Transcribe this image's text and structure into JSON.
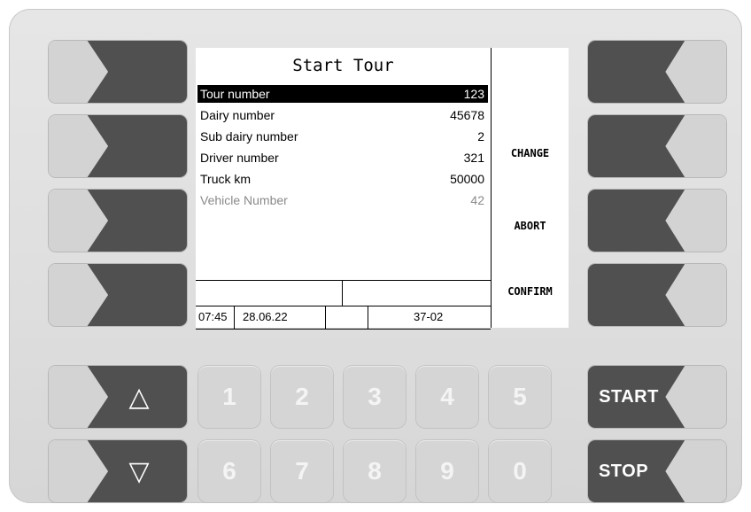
{
  "screen": {
    "title": "Start Tour",
    "rows": [
      {
        "label": "Tour number",
        "value": "123"
      },
      {
        "label": "Dairy number",
        "value": "45678"
      },
      {
        "label": "Sub dairy number",
        "value": "2"
      },
      {
        "label": "Driver number",
        "value": "321"
      },
      {
        "label": "Truck km",
        "value": "50000"
      },
      {
        "label": "Vehicle Number",
        "value": "42"
      }
    ],
    "softkeys": {
      "change": "CHANGE",
      "abort": "ABORT",
      "confirm": "CONFIRM"
    },
    "status": {
      "time": "07:45",
      "date": "28.06.22",
      "code": "37-02"
    }
  },
  "keypad": {
    "up": "△",
    "down": "▽",
    "digits_top": [
      "1",
      "2",
      "3",
      "4",
      "5"
    ],
    "digits_bottom": [
      "6",
      "7",
      "8",
      "9",
      "0"
    ],
    "start": "START",
    "stop": "STOP"
  },
  "colors": {
    "key_dark": "#505050",
    "key_light": "#d3d3d3",
    "panel": "#dedede",
    "highlight": "#000000"
  }
}
